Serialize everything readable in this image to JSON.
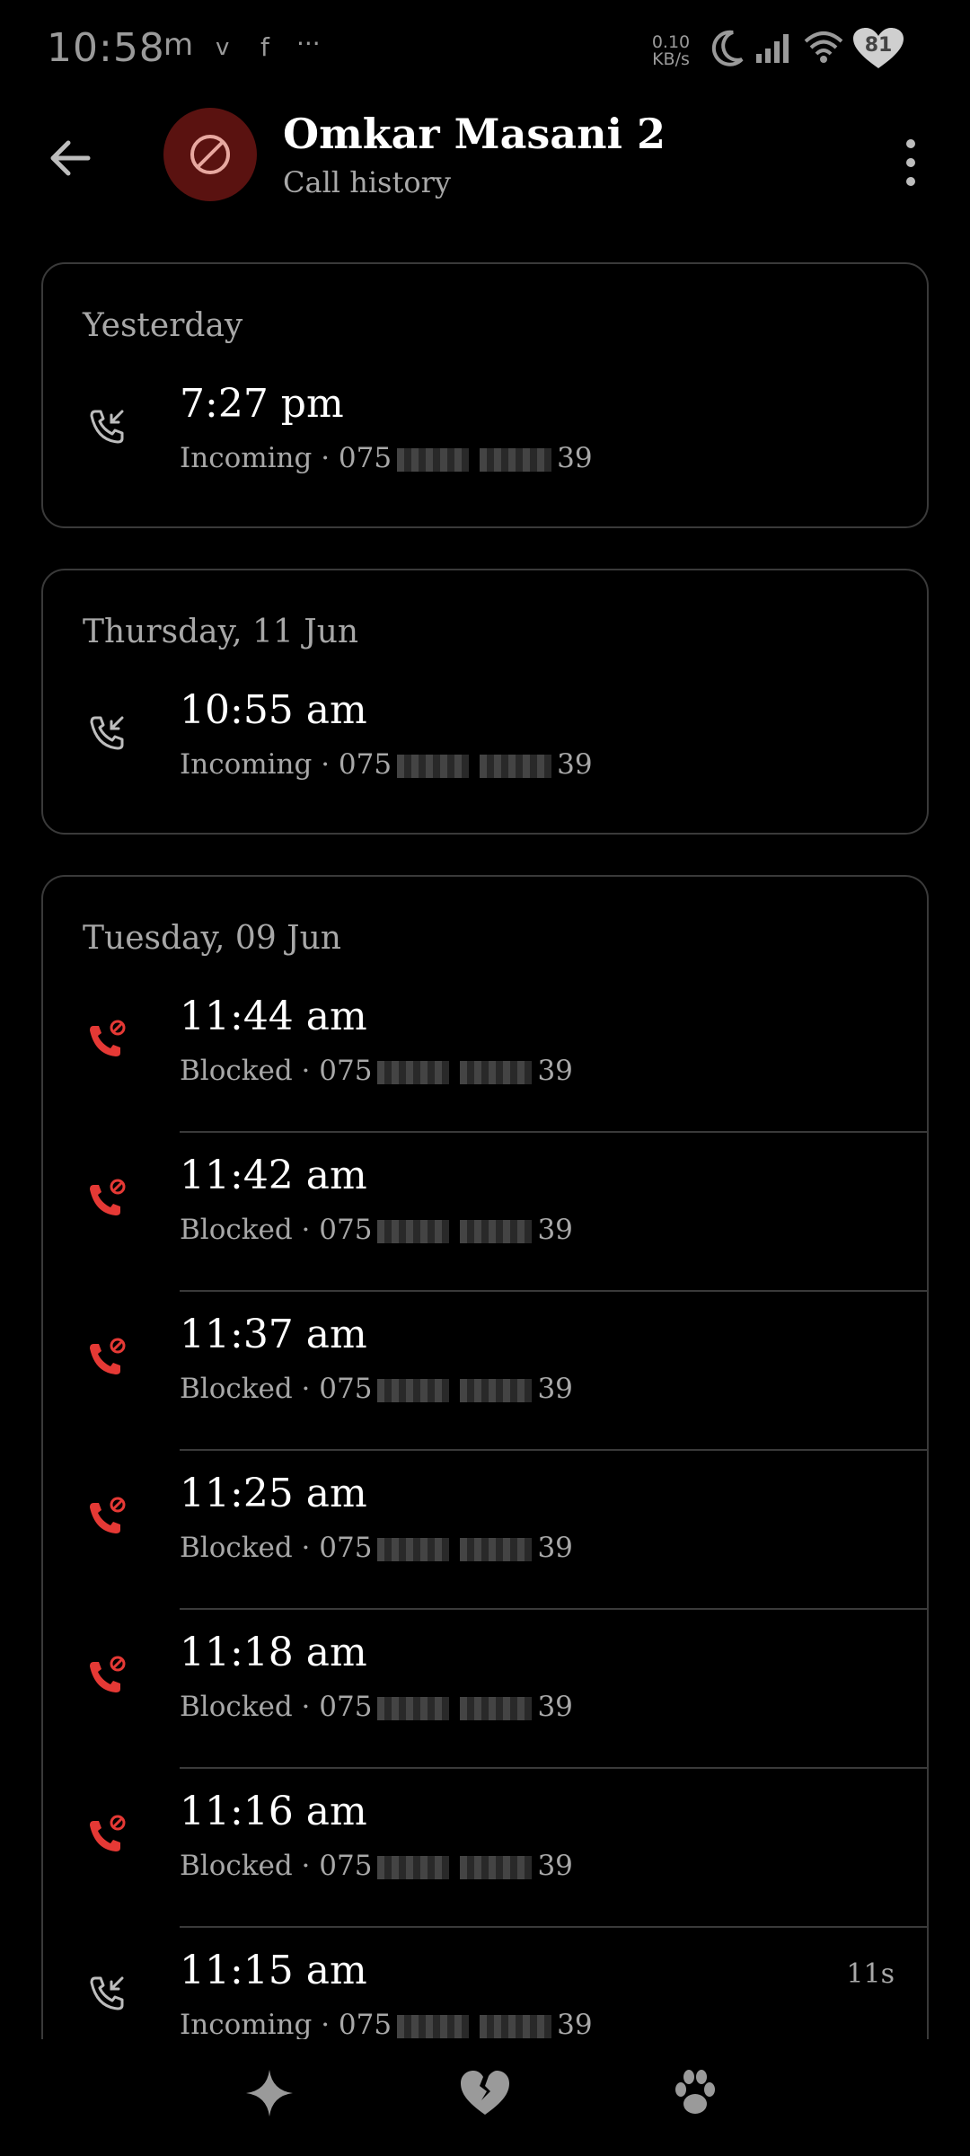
{
  "status_bar": {
    "time": "10:58",
    "notifications": [
      "m",
      "v",
      "f",
      "···"
    ],
    "net_speed_value": "0.10",
    "net_speed_unit": "KB/s",
    "battery": "81"
  },
  "header": {
    "title": "Omkar Masani 2",
    "subtitle": "Call history",
    "avatar_icon": "blocked-icon"
  },
  "groups": [
    {
      "date": "Yesterday",
      "calls": [
        {
          "time": "7:27 pm",
          "type": "Incoming",
          "number_prefix": "075",
          "number_suffix": "39",
          "icon": "incoming-call-icon"
        }
      ]
    },
    {
      "date": "Thursday, 11 Jun",
      "calls": [
        {
          "time": "10:55 am",
          "type": "Incoming",
          "number_prefix": "075",
          "number_suffix": "39",
          "icon": "incoming-call-icon"
        }
      ]
    },
    {
      "date": "Tuesday, 09 Jun",
      "calls": [
        {
          "time": "11:44 am",
          "type": "Blocked",
          "number_prefix": "075",
          "number_suffix": "39",
          "icon": "blocked-call-icon"
        },
        {
          "time": "11:42 am",
          "type": "Blocked",
          "number_prefix": "075",
          "number_suffix": "39",
          "icon": "blocked-call-icon"
        },
        {
          "time": "11:37 am",
          "type": "Blocked",
          "number_prefix": "075",
          "number_suffix": "39",
          "icon": "blocked-call-icon"
        },
        {
          "time": "11:25 am",
          "type": "Blocked",
          "number_prefix": "075",
          "number_suffix": "39",
          "icon": "blocked-call-icon"
        },
        {
          "time": "11:18 am",
          "type": "Blocked",
          "number_prefix": "075",
          "number_suffix": "39",
          "icon": "blocked-call-icon"
        },
        {
          "time": "11:16 am",
          "type": "Blocked",
          "number_prefix": "075",
          "number_suffix": "39",
          "icon": "blocked-call-icon"
        },
        {
          "time": "11:15 am",
          "type": "Incoming",
          "number_prefix": "075",
          "number_suffix": "39",
          "duration": "11s",
          "icon": "incoming-call-icon"
        }
      ]
    }
  ],
  "bottom_nav": [
    "sparkle-icon",
    "broken-heart-icon",
    "paw-icon"
  ],
  "colors": {
    "background": "#000000",
    "blocked_red": "#e53935",
    "avatar_bg": "#5a1210",
    "muted_text": "#a8a8a8",
    "border": "#3a3a3a"
  }
}
